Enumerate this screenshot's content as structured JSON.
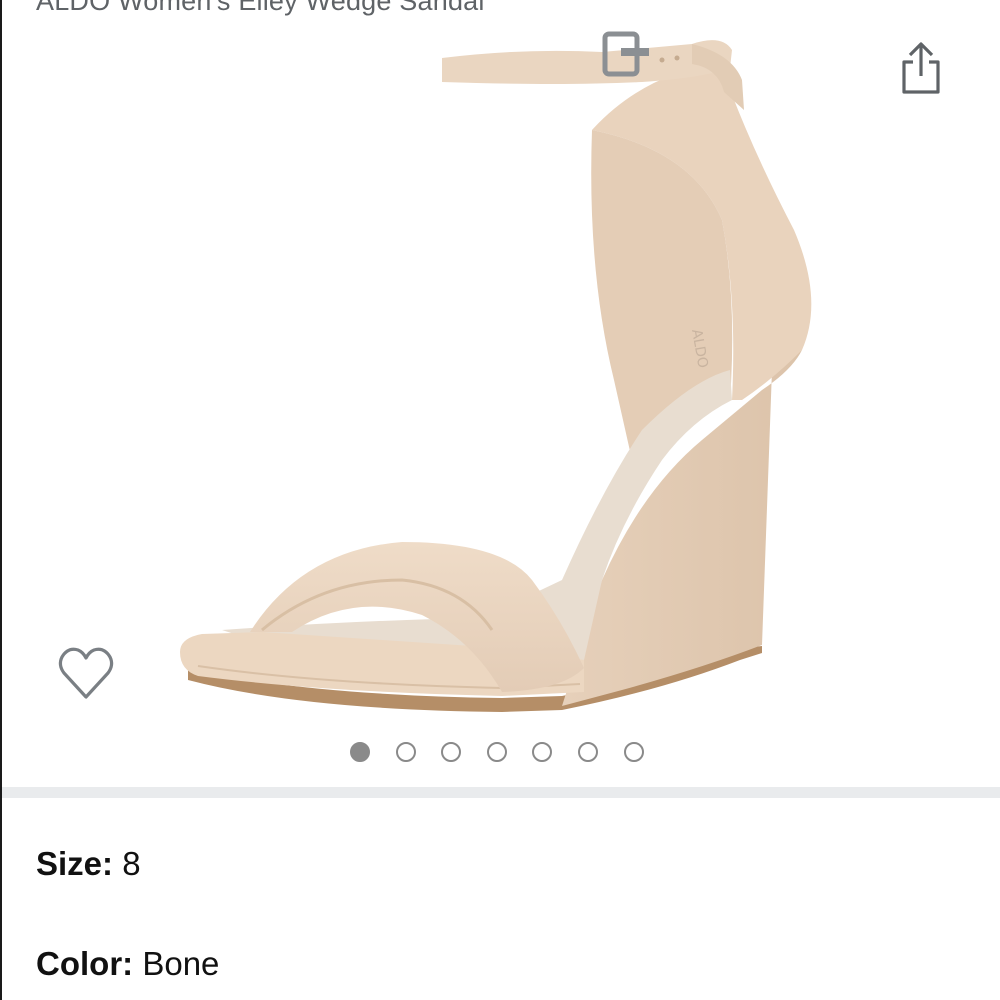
{
  "product": {
    "title": "ALDO Women's Elley Wedge Sandal"
  },
  "gallery": {
    "image_count": 7,
    "active_index": 0
  },
  "attributes": {
    "size": {
      "label": "Size:",
      "value": "8"
    },
    "color": {
      "label": "Color:",
      "value": "Bone"
    }
  },
  "icons": {
    "share": "share-icon",
    "wishlist": "heart-outline-icon"
  },
  "colors": {
    "icon_gray": "#5f6367",
    "dot_gray": "#8a8a8a",
    "divider": "#e9ebed",
    "sandal_suede": "#ecd8c3"
  }
}
